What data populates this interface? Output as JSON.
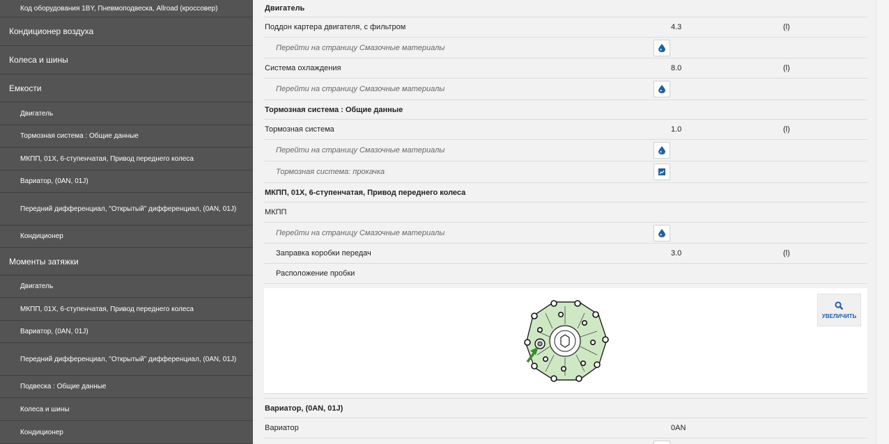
{
  "sidebar": {
    "items": [
      {
        "label": "Код оборудования 1BY, Пневмоподвеска, Allroad (кроссовер)",
        "level": 2
      },
      {
        "label": "Кондиционер воздуха",
        "level": 1
      },
      {
        "label": "Колеса и шины",
        "level": 1
      },
      {
        "label": "Емкости",
        "level": 1
      },
      {
        "label": "Двигатель",
        "level": 2
      },
      {
        "label": "Тормозная система : Общие данные",
        "level": 2
      },
      {
        "label": "МКПП, 01X, 6-ступенчатая, Привод переднего колеса",
        "level": 2
      },
      {
        "label": "Вариатор, (0AN, 01J)",
        "level": 2
      },
      {
        "label": "Передний дифференциал, \"Открытый\" дифференциал, (0AN, 01J)",
        "level": 2
      },
      {
        "label": "Кондиционер",
        "level": 2
      },
      {
        "label": "Моменты затяжки",
        "level": 1
      },
      {
        "label": "Двигатель",
        "level": 2
      },
      {
        "label": "МКПП, 01X, 6-ступенчатая, Привод переднего колеса",
        "level": 2
      },
      {
        "label": "Вариатор, (0AN, 01J)",
        "level": 2
      },
      {
        "label": "Передний дифференциал, \"Открытый\" дифференциал, (0AN, 01J)",
        "level": 2
      },
      {
        "label": "Подвеска : Общие данные",
        "level": 2
      },
      {
        "label": "Колеса и шины",
        "level": 2
      },
      {
        "label": "Кондиционер",
        "level": 2
      }
    ]
  },
  "content": {
    "rows": [
      {
        "type": "section",
        "label": "Двигатель"
      },
      {
        "type": "data",
        "label": "Поддон картера двигателя, с фильтром",
        "value": "4.3",
        "unit": "(l)"
      },
      {
        "type": "link",
        "label": "Перейти на страницу Смазочные материалы",
        "icon": "droplet-icon"
      },
      {
        "type": "data",
        "label": "Система охлаждения",
        "value": "8.0",
        "unit": "(l)"
      },
      {
        "type": "link",
        "label": "Перейти на страницу Смазочные материалы",
        "icon": "droplet-icon"
      },
      {
        "type": "section",
        "label": "Тормозная система : Общие данные"
      },
      {
        "type": "data",
        "label": "Тормозная система",
        "value": "1.0",
        "unit": "(l)"
      },
      {
        "type": "link",
        "label": "Перейти на страницу Смазочные материалы",
        "icon": "droplet-icon"
      },
      {
        "type": "link",
        "label": "Тормозная система: прокачка",
        "icon": "document-icon"
      },
      {
        "type": "section",
        "label": "МКПП, 01X, 6-ступенчатая, Привод переднего колеса"
      },
      {
        "type": "data",
        "label": "МКПП",
        "value": "",
        "unit": ""
      },
      {
        "type": "link",
        "label": "Перейти на страницу Смазочные материалы",
        "icon": "droplet-icon"
      },
      {
        "type": "sub",
        "label": "Заправка коробки передач",
        "value": "3.0",
        "unit": "(l)"
      },
      {
        "type": "sub",
        "label": "Расположение пробки",
        "value": "",
        "unit": ""
      }
    ],
    "zoom_label": "УВЕЛИЧИТЬ",
    "rows_after": [
      {
        "type": "section",
        "label": "Вариатор, (0AN, 01J)"
      },
      {
        "type": "data",
        "label": "Вариатор",
        "value": "0AN",
        "unit": ""
      }
    ]
  },
  "colors": {
    "sidebar_bg": "#545454",
    "accent_blue": "#1f5fa6",
    "diagram_green": "#cfe8c4",
    "arrow_green": "#3a8a2e"
  }
}
